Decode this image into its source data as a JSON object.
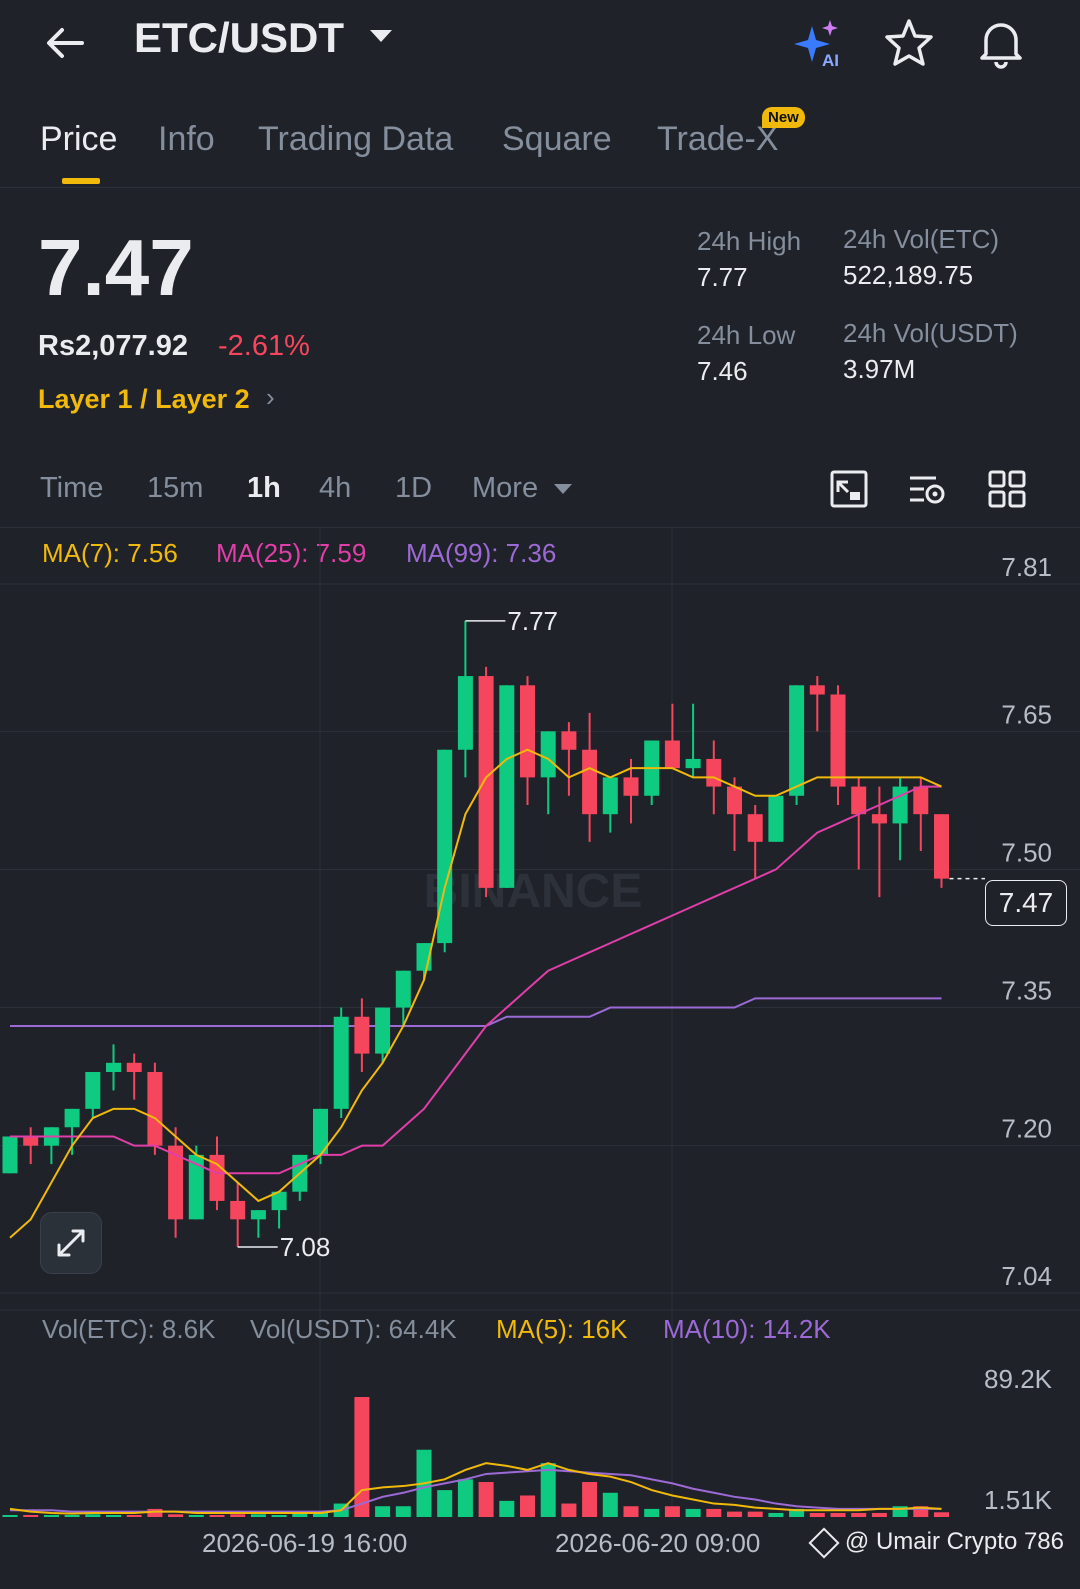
{
  "header": {
    "pair": "ETC/USDT",
    "ai_label": "AI",
    "icons": [
      "back-arrow-icon",
      "dropdown-caret-icon",
      "ai-sparkle-icon",
      "star-icon",
      "bell-icon"
    ]
  },
  "tabs": [
    {
      "label": "Price",
      "active": true
    },
    {
      "label": "Info"
    },
    {
      "label": "Trading Data"
    },
    {
      "label": "Square"
    },
    {
      "label": "Trade-X",
      "badge": "New"
    }
  ],
  "ticker": {
    "last_price": "7.47",
    "fiat_price": "Rs2,077.92",
    "change": "-2.61%",
    "tag": "Layer 1 / Layer 2",
    "high_label": "24h High",
    "high": "7.77",
    "low_label": "24h Low",
    "low": "7.46",
    "vol_etc_label": "24h Vol(ETC)",
    "vol_etc": "522,189.75",
    "vol_usdt_label": "24h Vol(USDT)",
    "vol_usdt": "3.97M"
  },
  "timeframes": [
    {
      "label": "Time"
    },
    {
      "label": "15m"
    },
    {
      "label": "1h",
      "active": true
    },
    {
      "label": "4h"
    },
    {
      "label": "1D"
    },
    {
      "label": "More"
    }
  ],
  "indicators": {
    "ma7": "MA(7): 7.56",
    "ma25": "MA(25): 7.59",
    "ma99": "MA(99): 7.36",
    "vol_etc": "Vol(ETC): 8.6K",
    "vol_usdt": "Vol(USDT): 64.4K",
    "vma5": "MA(5): 16K",
    "vma10": "MA(10): 14.2K"
  },
  "colors": {
    "up": "#0ecb81",
    "down": "#f6465d",
    "ma7": "#f0b90b",
    "ma25": "#e03ea8",
    "ma99": "#9c6ad6",
    "accent": "#f0b90b"
  },
  "watermark_bg": "BINANCE",
  "footer": {
    "date1": "2026-06-19 16:00",
    "date2": "2026-06-20 09:00",
    "credit": "@ Umair Crypto 786"
  },
  "chart_data": {
    "type": "candlestick",
    "price_axis_ticks": [
      "7.81",
      "7.65",
      "7.50",
      "7.35",
      "7.20",
      "7.04"
    ],
    "volume_axis_ticks": [
      "89.2K",
      "1.51K"
    ],
    "current_price_label": "7.47",
    "high_marker": "7.77",
    "low_marker": "7.08",
    "ylim": [
      7.04,
      7.81
    ],
    "candles": [
      [
        7.17,
        7.21,
        7.17,
        7.21
      ],
      [
        7.21,
        7.22,
        7.18,
        7.2
      ],
      [
        7.2,
        7.22,
        7.18,
        7.22
      ],
      [
        7.22,
        7.24,
        7.19,
        7.24
      ],
      [
        7.24,
        7.28,
        7.23,
        7.28
      ],
      [
        7.28,
        7.31,
        7.26,
        7.29
      ],
      [
        7.29,
        7.3,
        7.25,
        7.28
      ],
      [
        7.28,
        7.29,
        7.19,
        7.2
      ],
      [
        7.2,
        7.22,
        7.1,
        7.12
      ],
      [
        7.12,
        7.2,
        7.12,
        7.19
      ],
      [
        7.19,
        7.21,
        7.13,
        7.14
      ],
      [
        7.14,
        7.16,
        7.09,
        7.12
      ],
      [
        7.12,
        7.13,
        7.1,
        7.13
      ],
      [
        7.13,
        7.15,
        7.11,
        7.15
      ],
      [
        7.15,
        7.19,
        7.14,
        7.19
      ],
      [
        7.19,
        7.24,
        7.18,
        7.24
      ],
      [
        7.24,
        7.35,
        7.23,
        7.34
      ],
      [
        7.34,
        7.36,
        7.28,
        7.3
      ],
      [
        7.3,
        7.35,
        7.29,
        7.35
      ],
      [
        7.35,
        7.39,
        7.33,
        7.39
      ],
      [
        7.39,
        7.42,
        7.38,
        7.42
      ],
      [
        7.42,
        7.63,
        7.41,
        7.63
      ],
      [
        7.63,
        7.77,
        7.6,
        7.71
      ],
      [
        7.71,
        7.72,
        7.47,
        7.48
      ],
      [
        7.48,
        7.7,
        7.48,
        7.7
      ],
      [
        7.7,
        7.71,
        7.57,
        7.6
      ],
      [
        7.6,
        7.65,
        7.56,
        7.65
      ],
      [
        7.65,
        7.66,
        7.58,
        7.63
      ],
      [
        7.63,
        7.67,
        7.53,
        7.56
      ],
      [
        7.56,
        7.6,
        7.54,
        7.6
      ],
      [
        7.6,
        7.62,
        7.55,
        7.58
      ],
      [
        7.58,
        7.64,
        7.57,
        7.64
      ],
      [
        7.64,
        7.68,
        7.61,
        7.61
      ],
      [
        7.61,
        7.68,
        7.6,
        7.62
      ],
      [
        7.62,
        7.64,
        7.56,
        7.59
      ],
      [
        7.59,
        7.6,
        7.52,
        7.56
      ],
      [
        7.56,
        7.57,
        7.49,
        7.53
      ],
      [
        7.53,
        7.58,
        7.53,
        7.58
      ],
      [
        7.58,
        7.7,
        7.57,
        7.7
      ],
      [
        7.7,
        7.71,
        7.65,
        7.69
      ],
      [
        7.69,
        7.7,
        7.57,
        7.59
      ],
      [
        7.59,
        7.6,
        7.5,
        7.56
      ],
      [
        7.56,
        7.59,
        7.47,
        7.55
      ],
      [
        7.55,
        7.6,
        7.51,
        7.59
      ],
      [
        7.59,
        7.6,
        7.52,
        7.56
      ],
      [
        7.56,
        7.56,
        7.48,
        7.49
      ]
    ],
    "ma7": [
      7.1,
      7.12,
      7.16,
      7.2,
      7.23,
      7.24,
      7.24,
      7.23,
      7.21,
      7.19,
      7.18,
      7.16,
      7.14,
      7.15,
      7.17,
      7.19,
      7.22,
      7.26,
      7.29,
      7.33,
      7.38,
      7.48,
      7.56,
      7.6,
      7.62,
      7.63,
      7.62,
      7.6,
      7.61,
      7.6,
      7.61,
      7.61,
      7.61,
      7.6,
      7.6,
      7.59,
      7.58,
      7.58,
      7.59,
      7.6,
      7.6,
      7.6,
      7.6,
      7.6,
      7.6,
      7.59
    ],
    "ma25": [
      7.21,
      7.21,
      7.21,
      7.21,
      7.21,
      7.21,
      7.2,
      7.2,
      7.19,
      7.18,
      7.17,
      7.17,
      7.17,
      7.17,
      7.18,
      7.19,
      7.19,
      7.2,
      7.2,
      7.22,
      7.24,
      7.27,
      7.3,
      7.33,
      7.35,
      7.37,
      7.39,
      7.4,
      7.41,
      7.42,
      7.43,
      7.44,
      7.45,
      7.46,
      7.47,
      7.48,
      7.49,
      7.5,
      7.52,
      7.54,
      7.55,
      7.56,
      7.57,
      7.58,
      7.59,
      7.59
    ],
    "ma99": [
      7.33,
      7.33,
      7.33,
      7.33,
      7.33,
      7.33,
      7.33,
      7.33,
      7.33,
      7.33,
      7.33,
      7.33,
      7.33,
      7.33,
      7.33,
      7.33,
      7.33,
      7.33,
      7.33,
      7.33,
      7.33,
      7.33,
      7.33,
      7.33,
      7.34,
      7.34,
      7.34,
      7.34,
      7.34,
      7.35,
      7.35,
      7.35,
      7.35,
      7.35,
      7.35,
      7.35,
      7.36,
      7.36,
      7.36,
      7.36,
      7.36,
      7.36,
      7.36,
      7.36,
      7.36,
      7.36
    ],
    "volume": [
      1.5,
      1.5,
      1.5,
      1.5,
      2,
      1.5,
      1.5,
      6,
      2,
      1.5,
      1.5,
      2,
      2,
      1.5,
      3,
      3,
      10,
      89.2,
      8,
      8,
      50,
      20,
      28,
      26,
      12,
      16,
      40,
      10,
      26,
      18,
      8,
      6,
      8,
      6,
      6,
      4,
      4,
      3,
      6,
      3,
      3,
      3,
      3,
      8,
      8,
      3.5
    ],
    "vol_ma5": [
      6,
      4,
      3,
      2.5,
      3,
      3,
      3,
      4,
      4,
      3,
      3,
      3,
      3,
      3,
      3,
      3,
      5,
      20,
      22,
      23,
      25,
      28,
      35,
      40,
      38,
      35,
      40,
      35,
      32,
      30,
      26,
      20,
      16,
      13,
      10,
      9,
      7,
      6,
      5,
      5,
      5,
      5,
      6,
      6,
      7,
      6
    ],
    "vol_ma10": [
      5,
      5,
      5,
      4,
      4,
      4,
      4,
      4,
      4,
      4,
      4,
      4,
      4,
      4,
      4,
      4,
      5,
      10,
      15,
      18,
      22,
      25,
      28,
      32,
      33,
      34,
      35,
      34,
      33,
      32,
      31,
      28,
      25,
      21,
      18,
      15,
      13,
      10,
      8,
      7,
      6,
      6,
      6,
      6,
      6,
      6
    ]
  }
}
